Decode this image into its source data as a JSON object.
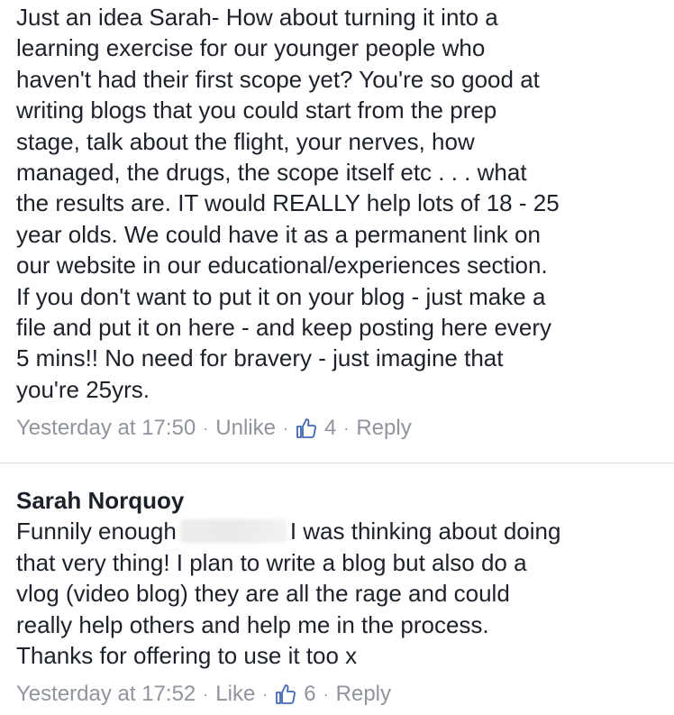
{
  "comments": [
    {
      "text": "Just an idea Sarah- How about turning it into a\nlearning exercise for our younger people who\nhaven't had their first scope yet? You're so good at\nwriting blogs that you could start from the prep\nstage, talk about the flight, your nerves, how\nmanaged, the drugs, the scope itself etc . . . what\nthe results are. IT would REALLY help lots of 18 - 25\nyear olds. We could have it as a permanent link on\nour website in our educational/experiences section.\nIf you don't want to put it on your blog - just make a\nfile and put it on here - and keep posting here every\n5 mins!! No need for bravery - just imagine that\nyou're 25yrs.",
      "timestamp": "Yesterday at 17:50",
      "like_action": "Unlike",
      "like_count": "4",
      "reply_action": "Reply",
      "icon": "thumbs-up-icon",
      "icon_color": "#4267b2"
    },
    {
      "author": "Sarah Norquoy",
      "text_before": "Funnily enough",
      "text_after": "I was thinking about doing\nthat very thing! I plan to write a blog but also do a\nvlog (video blog) they are all the rage and could\nreally help others and help me in the process.\nThanks for offering to use it too x",
      "timestamp": "Yesterday at 17:52",
      "like_action": "Like",
      "like_count": "6",
      "reply_action": "Reply",
      "icon": "thumbs-up-icon",
      "icon_color": "#4267b2"
    }
  ],
  "separator": "·"
}
